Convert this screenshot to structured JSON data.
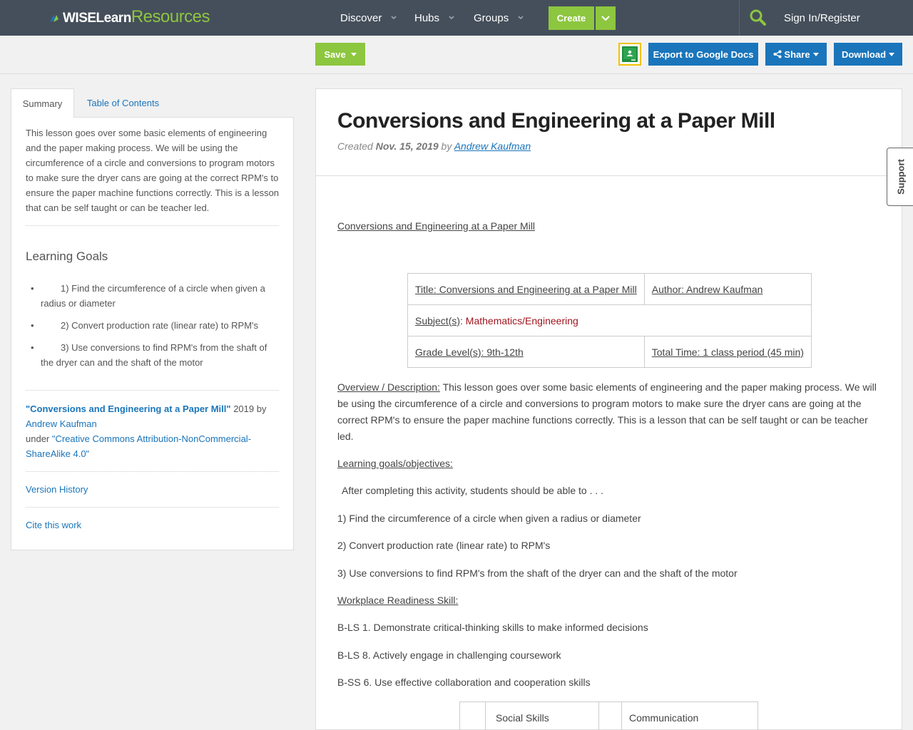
{
  "nav": {
    "logo_wise": "WISELearn",
    "logo_resources": "Resources",
    "items": [
      {
        "label": "Discover"
      },
      {
        "label": "Hubs"
      },
      {
        "label": "Groups"
      }
    ],
    "create_label": "Create",
    "signin_label": "Sign In/Register"
  },
  "toolbar": {
    "save_label": "Save",
    "export_label": "Export to Google Docs",
    "share_label": "Share",
    "download_label": "Download"
  },
  "sidebar": {
    "tabs": [
      {
        "label": "Summary"
      },
      {
        "label": "Table of Contents"
      }
    ],
    "summary": "This lesson goes over some basic elements of engineering and the paper making process. We will be using the circumference of a circle and conversions to program motors to make sure the dryer cans are going at the correct RPM's to ensure the paper machine functions correctly. This is a lesson that can be self taught or can be teacher led.",
    "goals_heading": "Learning Goals",
    "goals": [
      "1) Find the circumference of a circle when given a radius or diameter",
      "2) Convert production rate (linear rate) to RPM's",
      "3) Use conversions to find RPM's from the shaft of the dryer can and the shaft of the motor"
    ],
    "attribution": {
      "work_title": "\"Conversions and Engineering at a Paper Mill\"",
      "year_by": "2019 by",
      "author": "Andrew Kaufman",
      "under": "under",
      "license": "\"Creative Commons Attribution-NonCommercial-ShareAlike 4.0\""
    },
    "version_history": "Version History",
    "cite": "Cite this work"
  },
  "main": {
    "title": "Conversions and Engineering at a Paper Mill",
    "created_prefix": "Created",
    "created_date": "Nov. 15, 2019",
    "by": "by",
    "author": "Andrew Kaufman",
    "doc_heading": "Conversions and Engineering at a Paper Mill",
    "info_table": {
      "title": "Title: Conversions and Engineering at a Paper Mill",
      "author": "Author: Andrew Kaufman",
      "subject_label": "Subject(s)",
      "subject_colon": ":",
      "subject_value": " Mathematics/Engineering",
      "grade": "Grade Level(s): 9th-12th",
      "time": "Total Time: 1 class period (45 min)"
    },
    "overview_label": "Overview / Description:",
    "overview_text": " This lesson goes over some basic elements of engineering and the paper making process. We will be using the circumference of a circle and conversions to program motors to make sure the dryer cans are going at the correct RPM's to ensure the paper machine functions correctly. This is a lesson that can be self taught or can be teacher led.",
    "goals_label": "Learning goals/objectives:",
    "goals_intro": "After completing this activity, students should be able to . . .",
    "goals": [
      "1) Find the circumference of a circle when given a radius or diameter",
      "2) Convert production rate (linear rate) to RPM's",
      "3) Use conversions to find RPM's from the shaft of the dryer can and the shaft of the motor"
    ],
    "workplace_label": "Workplace Readiness Skill:",
    "skills": [
      "B-LS 1. Demonstrate critical-thinking skills to make informed decisions",
      "B-LS 8. Actively engage in challenging coursework",
      "B-SS 6. Use effective collaboration and cooperation skills"
    ],
    "skills_table": [
      "Social Skills",
      "Communication"
    ]
  },
  "support_label": "Support",
  "colors": {
    "nav_bg": "#454f5b",
    "brand_green": "#8dc63f",
    "action_blue": "#1a75bb",
    "subject_red": "#a0141e"
  }
}
